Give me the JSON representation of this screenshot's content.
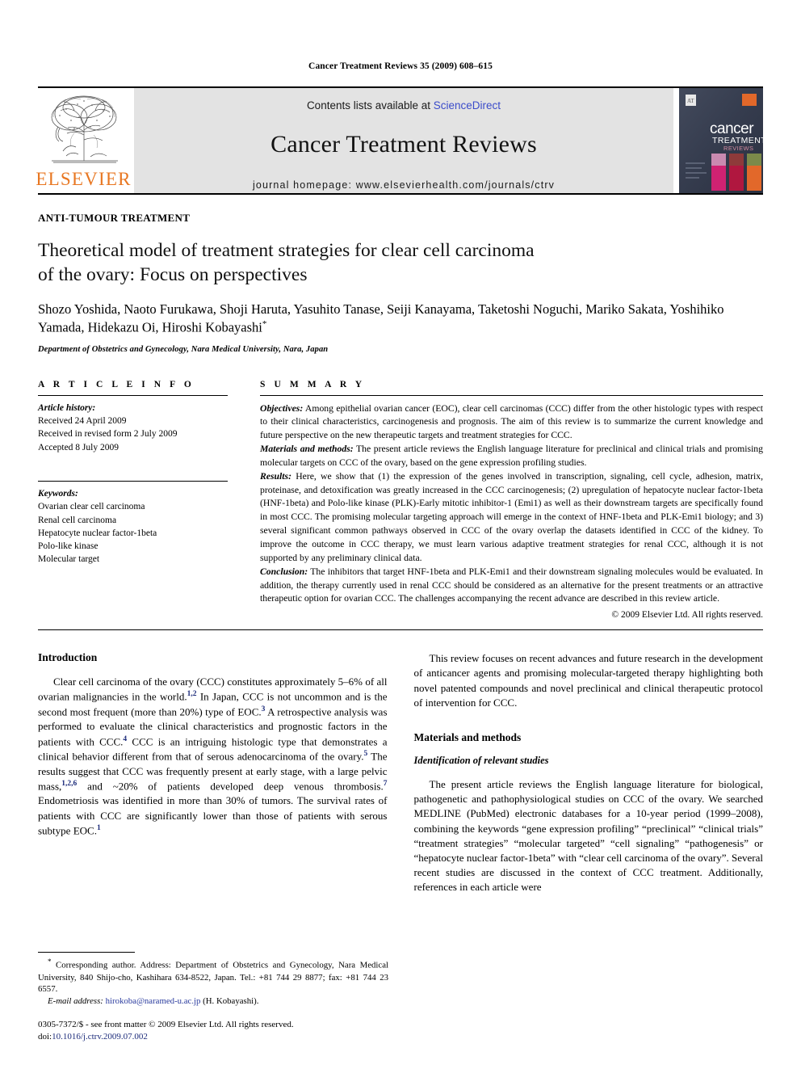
{
  "running_head": "Cancer Treatment Reviews 35 (2009) 608–615",
  "masthead": {
    "publisher_name": "ELSEVIER",
    "contents_prefix": "Contents lists available at ",
    "contents_link": "ScienceDirect",
    "journal_title": "Cancer Treatment Reviews",
    "homepage": "journal homepage: www.elsevierhealth.com/journals/ctrv",
    "cover_title_line1": "cancer",
    "cover_title_line2": "TREATMENT",
    "cover_title_line3": "REVIEWS",
    "accent_orange": "#E87722",
    "link_blue": "#3b4cca",
    "cover_bg": "#3a4152"
  },
  "kicker": "ANTI-TUMOUR TREATMENT",
  "title_line1": "Theoretical model of treatment strategies for clear cell carcinoma",
  "title_line2": "of the ovary: Focus on perspectives",
  "authors": "Shozo Yoshida, Naoto Furukawa, Shoji Haruta, Yasuhito Tanase, Seiji Kanayama, Taketoshi Noguchi, Mariko Sakata, Yoshihiko Yamada, Hidekazu Oi, Hiroshi Kobayashi",
  "author_marker": "*",
  "affiliation": "Department of Obstetrics and Gynecology, Nara Medical University, Nara, Japan",
  "article_info": {
    "heading": "A R T I C L E  I N F O",
    "history_label": "Article history:",
    "history": [
      "Received 24 April 2009",
      "Received in revised form 2 July 2009",
      "Accepted 8 July 2009"
    ],
    "keywords_label": "Keywords:",
    "keywords": [
      "Ovarian clear cell carcinoma",
      "Renal cell carcinoma",
      "Hepatocyte nuclear factor-1beta",
      "Polo-like kinase",
      "Molecular target"
    ]
  },
  "summary": {
    "heading": "S U M M A R Y",
    "objectives_label": "Objectives:",
    "objectives_text": " Among epithelial ovarian cancer (EOC), clear cell carcinomas (CCC) differ from the other histologic types with respect to their clinical characteristics, carcinogenesis and prognosis. The aim of this review is to summarize the current knowledge and future perspective on the new therapeutic targets and treatment strategies for CCC.",
    "materials_label": "Materials and methods:",
    "materials_text": " The present article reviews the English language literature for preclinical and clinical trials and promising molecular targets on CCC of the ovary, based on the gene expression profiling studies.",
    "results_label": "Results:",
    "results_text": " Here, we show that (1) the expression of the genes involved in transcription, signaling, cell cycle, adhesion, matrix, proteinase, and detoxification was greatly increased in the CCC carcinogenesis; (2) upregulation of hepatocyte nuclear factor-1beta (HNF-1beta) and Polo-like kinase (PLK)-Early mitotic inhibitor-1 (Emi1) as well as their downstream targets are specifically found in most CCC. The promising molecular targeting approach will emerge in the context of HNF-1beta and PLK-Emi1 biology; and 3) several significant common pathways observed in CCC of the ovary overlap the datasets identified in CCC of the kidney. To improve the outcome in CCC therapy, we must learn various adaptive treatment strategies for renal CCC, although it is not supported by any preliminary clinical data.",
    "conclusion_label": "Conclusion:",
    "conclusion_text": " The inhibitors that target HNF-1beta and PLK-Emi1 and their downstream signaling molecules would be evaluated. In addition, the therapy currently used in renal CCC should be considered as an alternative for the present treatments or an attractive therapeutic option for ovarian CCC. The challenges accompanying the recent advance are described in this review article.",
    "copyright": "© 2009 Elsevier Ltd. All rights reserved."
  },
  "left_column": {
    "intro_heading": "Introduction",
    "intro_p1_a": "Clear cell carcinoma of the ovary (CCC) constitutes approximately 5–6% of all ovarian malignancies in the world.",
    "intro_p1_sup1": "1,2",
    "intro_p1_b": " In Japan, CCC is not uncommon and is the second most frequent (more than 20%) type of EOC.",
    "intro_p1_sup2": "3",
    "intro_p1_c": " A retrospective analysis was performed to evaluate the clinical characteristics and prognostic factors in the patients with CCC.",
    "intro_p1_sup3": "4",
    "intro_p1_d": " CCC is an intriguing histologic type that demonstrates a clinical behavior different from that of serous adenocarcinoma of the ovary.",
    "intro_p1_sup4": "5",
    "intro_p1_e": " The results suggest that CCC was frequently present at early stage, with a large pelvic mass,",
    "intro_p1_sup5": "1,2,6",
    "intro_p1_f": " and ~20% of patients developed deep venous thrombosis.",
    "intro_p1_sup6": "7",
    "intro_p1_g": " Endometriosis was identified in more than 30% of tumors. The survival rates of patients with CCC are significantly lower than those of patients with serous subtype EOC.",
    "intro_p1_sup7": "1"
  },
  "right_column": {
    "p1": "This review focuses on recent advances and future research in the development of anticancer agents and promising molecular-targeted therapy highlighting both novel patented compounds and novel preclinical and clinical therapeutic protocol of intervention for CCC.",
    "materials_heading": "Materials and methods",
    "identification_subhead": "Identification of relevant studies",
    "p2": "The present article reviews the English language literature for biological, pathogenetic and pathophysiological studies on CCC of the ovary. We searched MEDLINE (PubMed) electronic databases for a 10-year period (1999–2008), combining the keywords “gene expression profiling” “preclinical” “clinical trials” “treatment strategies” “molecular targeted” “cell signaling” “pathogenesis” or “hepatocyte nuclear factor-1beta” with “clear cell carcinoma of the ovary”. Several recent studies are discussed in the context of CCC treatment. Additionally, references in each article were"
  },
  "footnote": {
    "marker": "*",
    "corresponding": " Corresponding author. Address: Department of Obstetrics and Gynecology, Nara Medical University, 840 Shijo-cho, Kashihara 634-8522, Japan. Tel.: +81 744 29 8877; fax: +81 744 23 6557.",
    "email_label": "E-mail address:",
    "email": "hirokoba@naramed-u.ac.jp",
    "email_suffix": " (H. Kobayashi).",
    "issn_line": "0305-7372/$ - see front matter © 2009 Elsevier Ltd. All rights reserved.",
    "doi_label": "doi:",
    "doi_value": "10.1016/j.ctrv.2009.07.002"
  }
}
